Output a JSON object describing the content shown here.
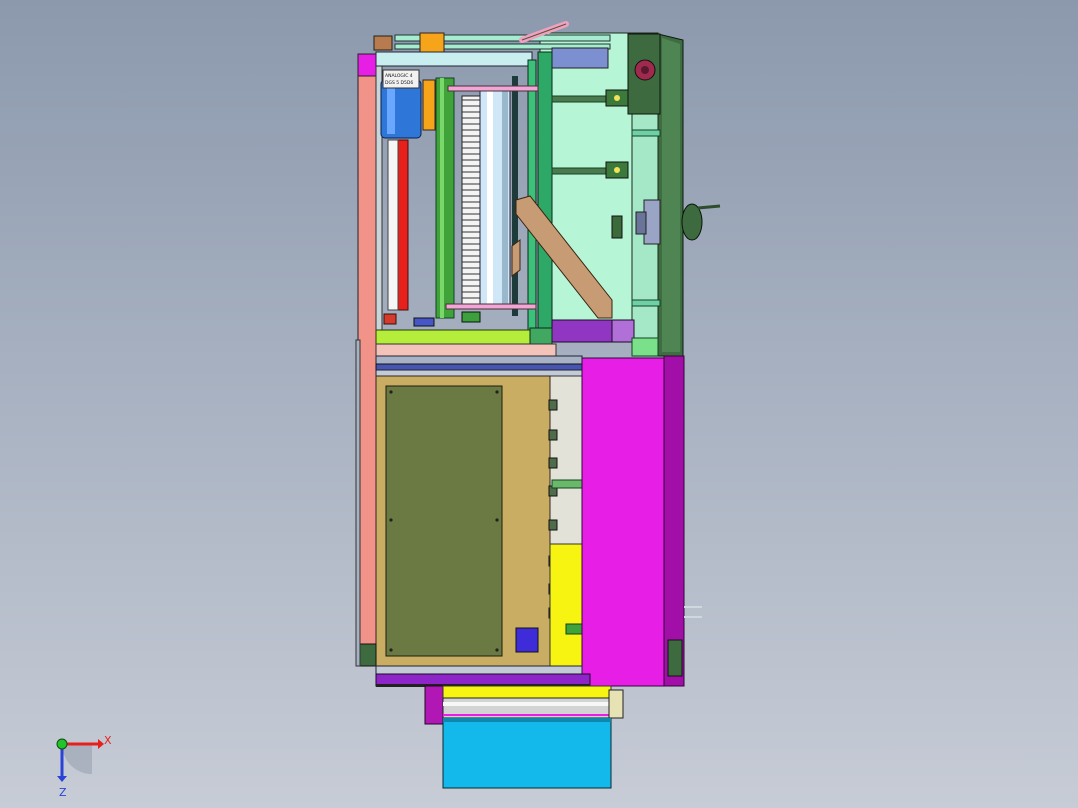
{
  "viewport": {
    "background_top": "#8c99ad",
    "background_bottom": "#c7ccd6"
  },
  "model": {
    "motor_nameplate_line1": "ANALOGIC 4",
    "motor_nameplate_line2": "DGS 5 D5D6"
  },
  "triad": {
    "x_label": "X",
    "z_label": "Z",
    "x_color": "#e8201c",
    "y_color": "#21c42a",
    "z_color": "#2a43d6"
  },
  "colors": {
    "magenta": "#e61ee6",
    "salmon": "#f2938a",
    "mint": "#b6f5d6",
    "dark_green": "#3d6b3f",
    "olive_panel": "#6b7a42",
    "tan_cabinet": "#c8ad63",
    "cyan_box": "#12b9ea",
    "yellow": "#f8f412",
    "lime": "#b4ee3a",
    "motor_blue": "#2e77d8",
    "purple": "#8d25c8",
    "brown_brace": "#c79b73"
  }
}
